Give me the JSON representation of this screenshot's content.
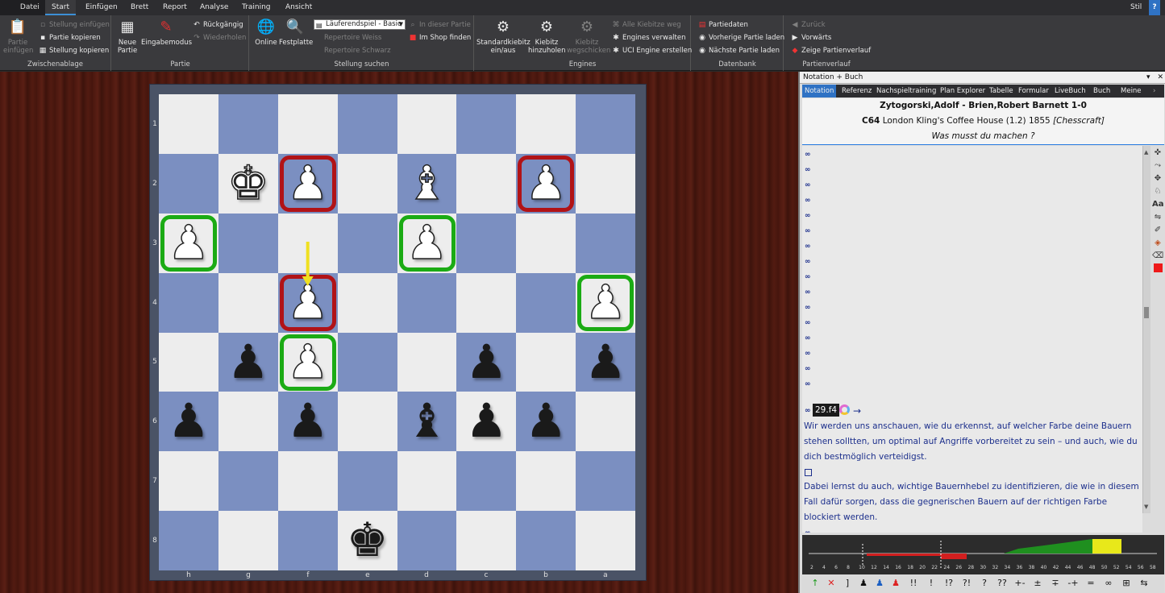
{
  "tabs": {
    "file": "Datei",
    "items": [
      "Start",
      "Einfügen",
      "Brett",
      "Report",
      "Analyse",
      "Training",
      "Ansicht"
    ],
    "style_label": "Stil"
  },
  "ribbon": {
    "zwischenablage": {
      "label": "Zwischenablage",
      "paste_game": "Partie einfügen",
      "paste_position": "Stellung einfügen",
      "copy_game": "Partie kopieren",
      "copy_position": "Stellung kopieren"
    },
    "partie": {
      "label": "Partie",
      "new_game": "Neue Partie",
      "input_mode": "Eingabemodus",
      "undo": "Rückgängig",
      "redo": "Wiederholen"
    },
    "stellung_suchen": {
      "label": "Stellung suchen",
      "online": "Online",
      "hard_disk": "Festplatte",
      "combo_value": "Läuferendspiel - Basic",
      "in_this_game": "In dieser Partie",
      "in_shop": "Im Shop finden",
      "repertoire_white": "Repertoire Weiss",
      "repertoire_black": "Repertoire Schwarz"
    },
    "engines": {
      "label": "Engines",
      "std_kibitz": "Standardkiebitz ein/aus",
      "kibitz_add": "Kiebitz hinzuholen",
      "kibitz_send": "Kiebitz wegschicken",
      "all_kibitz_away": "Alle Kiebitze weg",
      "manage_engines": "Engines verwalten",
      "uci_create": "UCI Engine erstellen"
    },
    "datenbank": {
      "label": "Datenbank",
      "game_data": "Partiedaten",
      "prev_game": "Vorherige Partie laden",
      "next_game": "Nächste Partie laden"
    },
    "partienverlauf": {
      "label": "Partienverlauf",
      "back": "Zurück",
      "forward": "Vorwärts",
      "show_history": "Zeige Partienverlauf"
    }
  },
  "board": {
    "ranks": [
      "1",
      "2",
      "3",
      "4",
      "5",
      "6",
      "7",
      "8"
    ],
    "files": [
      "h",
      "g",
      "f",
      "e",
      "d",
      "c",
      "b",
      "a"
    ]
  },
  "panel": {
    "title": "Notation + Buch",
    "tabs": [
      "Notation",
      "Referenz",
      "Nachspieltraining",
      "Plan Explorer",
      "Tabelle",
      "Formular",
      "LiveBuch",
      "Buch",
      "Meine"
    ],
    "header": {
      "players": "Zytogorski,Adolf - Brien,Robert Barnett  1-0",
      "eco": "C64",
      "event": " London Kling's Coffee House (1.2) 1855 ",
      "source": "[Chesscraft]",
      "question": "Was musst du machen ?"
    },
    "move": "29.f4",
    "para1_lines": [
      "Wir werden uns anschauen, wie du erkennst, auf welcher Farbe deine Bauern",
      "stehen solltten, um optimal auf Angriffe vorbereitet zu sein – und auch, wie du",
      "dich bestmöglich verteidigst."
    ],
    "para2_lines": [
      "Dabei lernst du auch, wichtige Bauernhebel zu identifizieren, die wie in diesem",
      "Fall dafür sorgen, dass die gegnerischen Bauern auf der richtigen Farbe",
      "blockiert werden."
    ],
    "eval_ticks": [
      "2",
      "4",
      "6",
      "8",
      "10",
      "12",
      "14",
      "16",
      "18",
      "20",
      "22",
      "24",
      "26",
      "28",
      "30",
      "32",
      "34",
      "36",
      "38",
      "40",
      "42",
      "44",
      "46",
      "48",
      "50",
      "52",
      "54",
      "56",
      "58"
    ],
    "symbols": [
      "!!",
      "!",
      "!?",
      "?!",
      "?",
      "??",
      "+-",
      "±",
      "∓",
      "-+",
      "=",
      "∞",
      "⊞",
      "⇆"
    ]
  }
}
